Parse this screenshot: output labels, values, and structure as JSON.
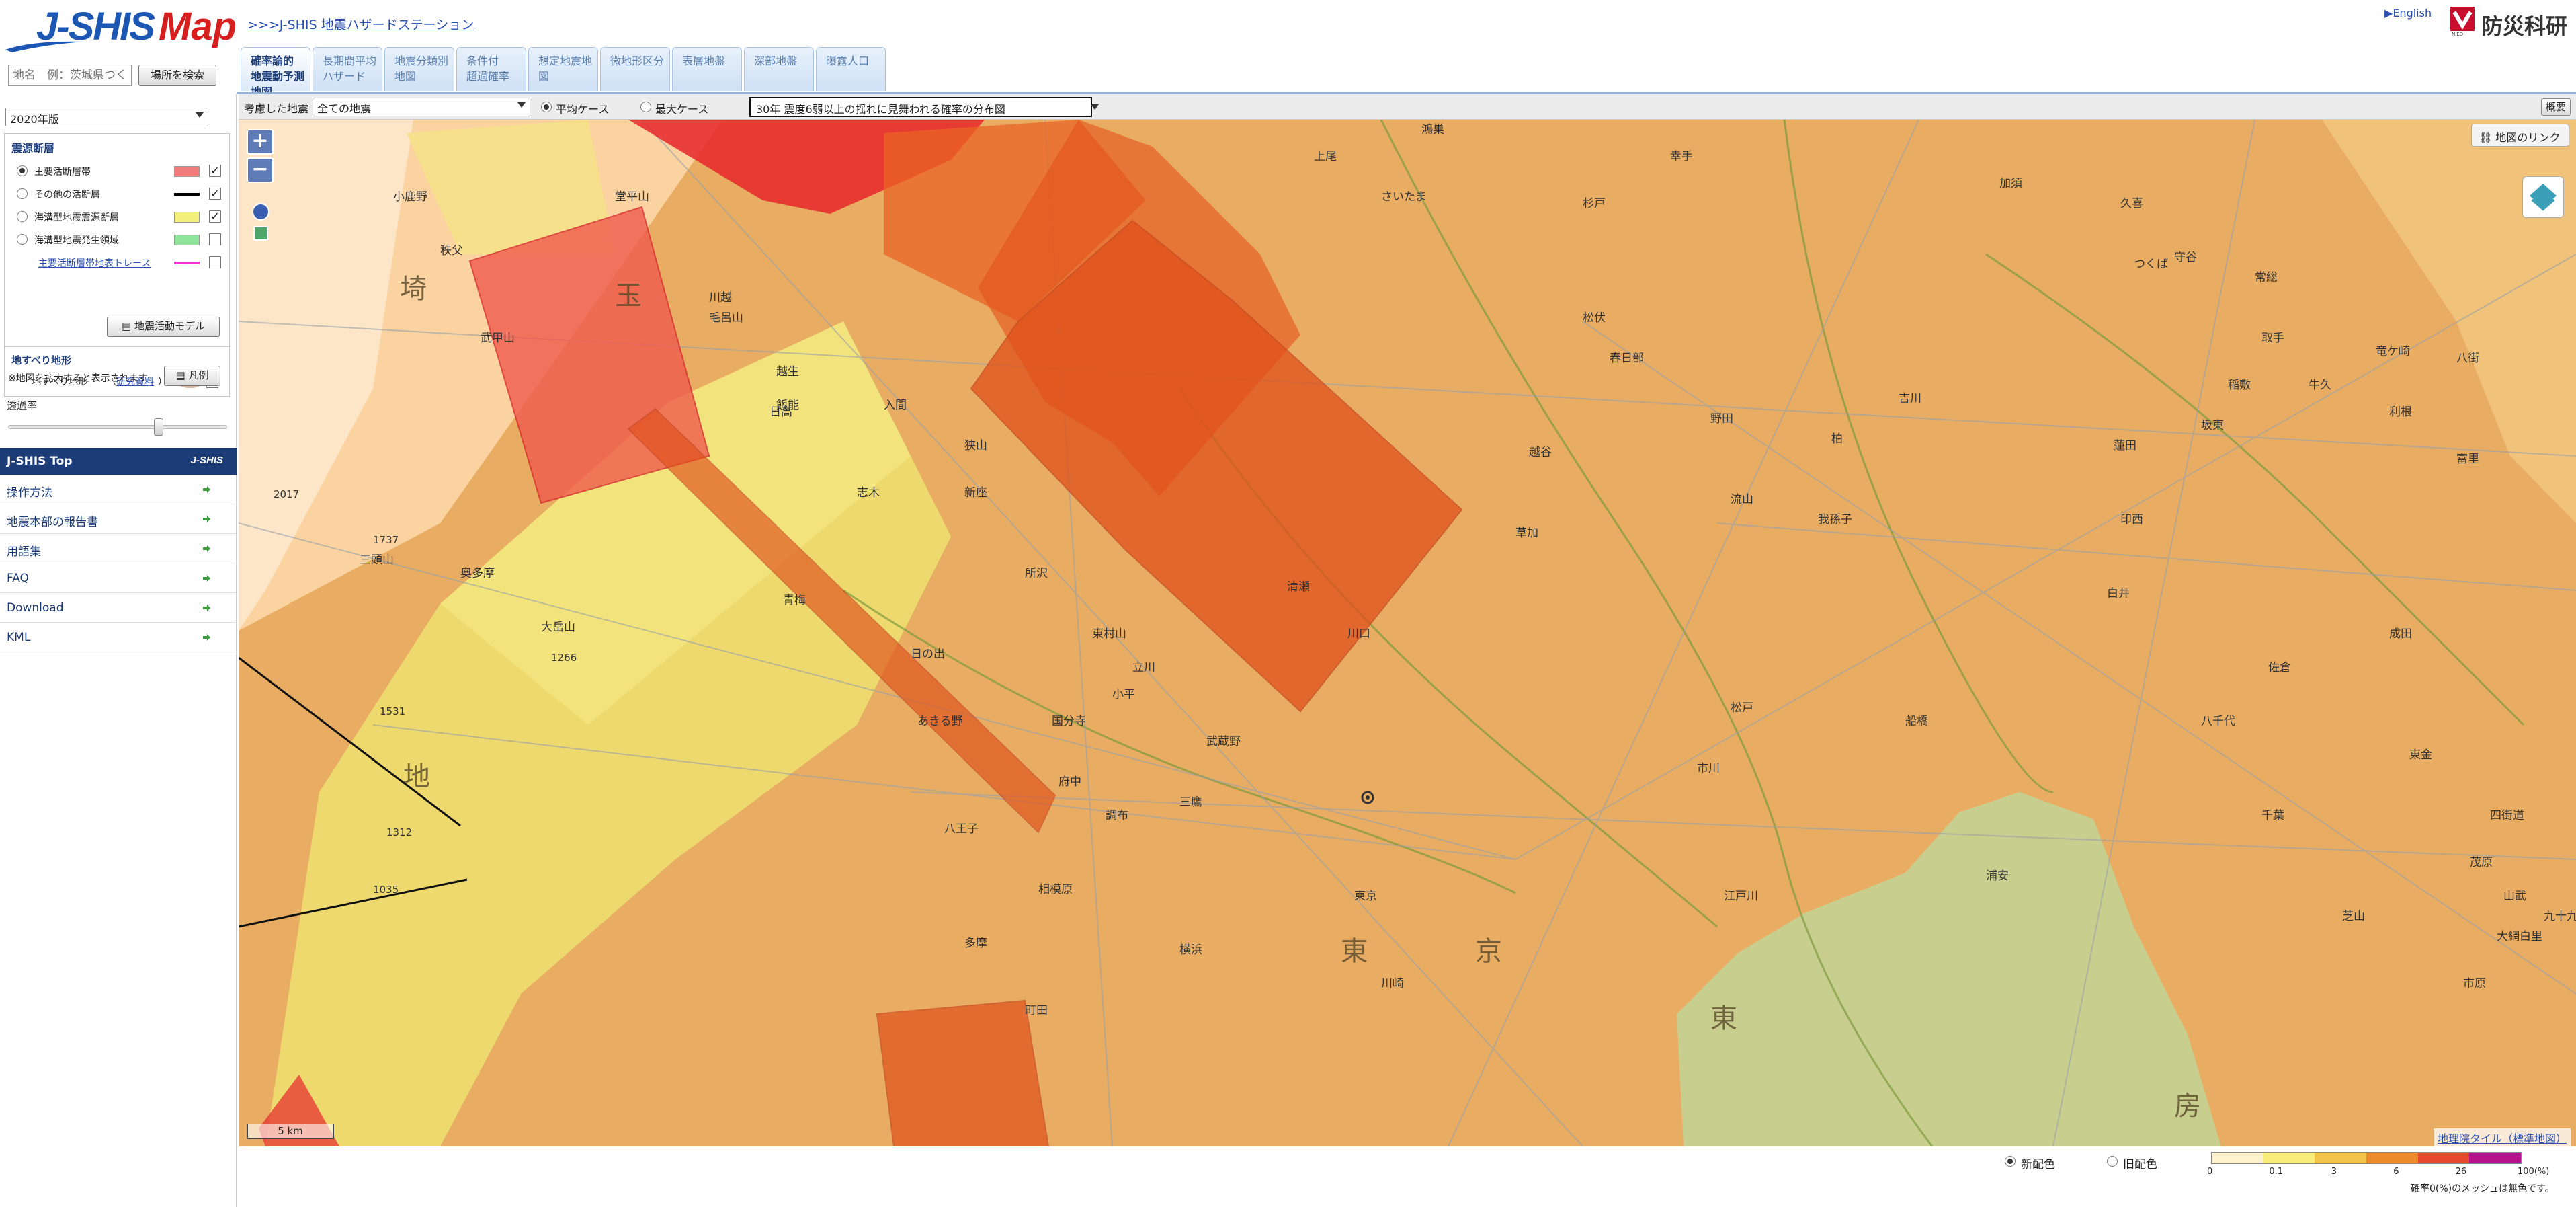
{
  "header": {
    "logo_main": "J-SHIS",
    "logo_map": "Map",
    "station_link": ">>>J-SHIS 地震ハザードステーション",
    "english_link": "English",
    "org_name": "防災科研",
    "search_placeholder": "地名　例：茨城県つくば市",
    "search_button": "場所を検索"
  },
  "tabs": [
    {
      "label": "確率論的\n地震動予測地図",
      "active": true
    },
    {
      "label": "長期間平均\nハザード",
      "active": false
    },
    {
      "label": "地震分類別\n地図",
      "active": false
    },
    {
      "label": "条件付\n超過確率",
      "active": false
    },
    {
      "label": "想定地震地図",
      "active": false
    },
    {
      "label": "微地形区分",
      "active": false
    },
    {
      "label": "表層地盤",
      "active": false
    },
    {
      "label": "深部地盤",
      "active": false
    },
    {
      "label": "曝露人口",
      "active": false
    }
  ],
  "selection_bar": {
    "label": "考慮した地震",
    "quake_select": "全ての地震",
    "case_average": "平均ケース",
    "case_max": "最大ケース",
    "prob_select": "30年 震度6弱以上の揺れに見舞われる確率の分布図",
    "gaiyo_button": "概要"
  },
  "sidebar": {
    "year_select": "2020年版",
    "fault_title": "震源断層",
    "faults": [
      {
        "label": "主要活断層帯",
        "color": "#f07c7c",
        "selected": true,
        "checked": true,
        "link": false
      },
      {
        "label": "その他の活断層",
        "color": "#000000",
        "selected": false,
        "checked": true,
        "link": false
      },
      {
        "label": "海溝型地震震源断層",
        "color": "#f3ef7c",
        "selected": false,
        "checked": true,
        "link": false
      },
      {
        "label": "海溝型地震発生領域",
        "color": "#8fe39a",
        "selected": false,
        "checked": false,
        "link": false
      },
      {
        "label": "主要活断層帯地表トレース",
        "color": "#ff33cc",
        "selected": false,
        "checked": false,
        "link": true
      }
    ],
    "model_button": "地震活動モデル",
    "landslide_title": "地すべり地形",
    "landslide_label": "地すべり地形",
    "landslide_link": "研究資料",
    "landslide_note": "※地図を拡大すると表示されます",
    "legend_button": "凡例",
    "transparency_label": "透過率",
    "transparency_value": 0.7,
    "top_title": "J-SHIS Top",
    "top_mini": "J-SHIS",
    "menu": [
      "操作方法",
      "地震本部の報告書",
      "用語集",
      "FAQ",
      "Download",
      "KML"
    ]
  },
  "map": {
    "zoom_in": "+",
    "zoom_out": "−",
    "map_link": "地図のリンク",
    "scale": "5 km",
    "gsi_tile": "地理院タイル（標準地図）",
    "place_labels": [
      "秩父",
      "小鹿野",
      "堂平山",
      "武甲山",
      "飯能",
      "青梅",
      "所沢",
      "奥多摩",
      "大岳山",
      "三頭山",
      "八王子",
      "日の出",
      "あきる野",
      "立川",
      "府中",
      "調布",
      "三鷹",
      "武蔵野",
      "国分寺",
      "小平",
      "東村山",
      "清瀬",
      "新座",
      "志木",
      "川越",
      "狭山",
      "入間",
      "日高",
      "毛呂山",
      "越生",
      "川口",
      "草加",
      "越谷",
      "春日部",
      "松伏",
      "野田",
      "流山",
      "柏",
      "我孫子",
      "松戸",
      "市川",
      "船橋",
      "白井",
      "印西",
      "成田",
      "佐倉",
      "八千代",
      "千葉",
      "四街道",
      "市原",
      "浦安",
      "相模原",
      "多摩",
      "町田",
      "横浜",
      "川崎",
      "江戸川",
      "東京",
      "さいたま",
      "上尾",
      "鴻巣",
      "杉戸",
      "幸手",
      "加須",
      "久喜",
      "蓮田",
      "吉川",
      "利根",
      "坂東",
      "常総",
      "守谷",
      "つくば",
      "取手",
      "竜ケ崎",
      "牛久",
      "稲敷",
      "富里",
      "八街",
      "茂原",
      "大網白里",
      "山武",
      "九十九里",
      "東金",
      "芝山"
    ],
    "big_labels": [
      "埼",
      "玉",
      "東",
      "京",
      "地",
      "房",
      "東"
    ],
    "peaks": [
      "2017",
      "1737",
      "1266",
      "1531",
      "1312",
      "1035"
    ]
  },
  "footer": {
    "color_new": "新配色",
    "color_old": "旧配色",
    "colorbar_colors": [
      "#fdf2cc",
      "#f8ec7a",
      "#f2c54a",
      "#ec8b2c",
      "#e44a2b",
      "#b6128a"
    ],
    "colorbar_ticks": [
      "0",
      "0.1",
      "3",
      "6",
      "26",
      "100(%)"
    ],
    "note": "確率0(%)のメッシュは無色です。"
  }
}
